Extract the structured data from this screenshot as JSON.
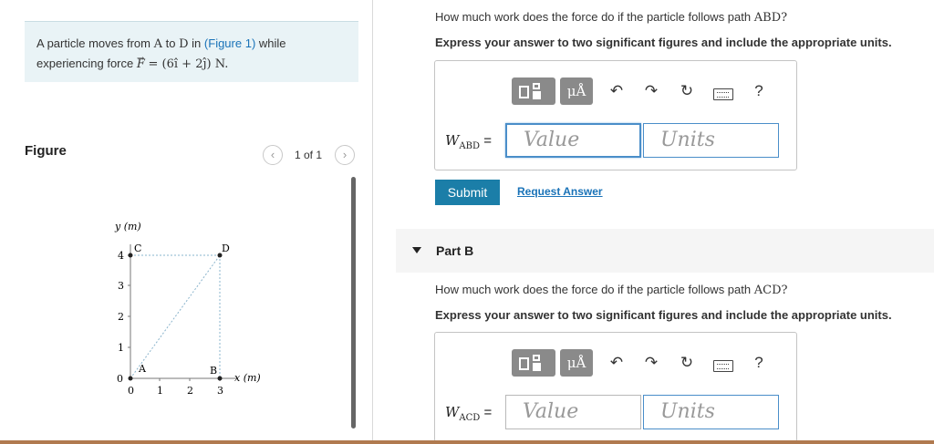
{
  "problem": {
    "text_1": "A particle moves from",
    "point_a": "A",
    "to": "to",
    "point_d": "D",
    "in": "in",
    "figure_link": "(Figure 1)",
    "while": "while",
    "text_2": "experiencing force",
    "force_symbol": "F",
    "force_eq": "= (6î + 2ĵ) N."
  },
  "figure": {
    "label": "Figure",
    "pager": "1 of 1",
    "prev_icon": "‹",
    "next_icon": "›"
  },
  "graph": {
    "ylabel": "y (m)",
    "xlabel": "x (m)",
    "x_ticks": [
      "0",
      "1",
      "2",
      "3"
    ],
    "y_ticks": [
      "1",
      "2",
      "3",
      "4"
    ],
    "y_zero": "0",
    "points": {
      "A": "A",
      "B": "B",
      "C": "C",
      "D": "D"
    }
  },
  "part_a": {
    "question": "How much work does the force do if the particle follows path",
    "path": "ABD?",
    "instruction": "Express your answer to two significant figures and include the appropriate units.",
    "var_main": "W",
    "var_sub": "ABD",
    "equals": "=",
    "value_placeholder": "Value",
    "units_placeholder": "Units",
    "submit": "Submit",
    "request": "Request Answer"
  },
  "part_b": {
    "title": "Part B",
    "question": "How much work does the force do if the particle follows path",
    "path": "ACD?",
    "instruction": "Express your answer to two significant figures and include the appropriate units.",
    "var_main": "W",
    "var_sub": "ACD",
    "equals": "=",
    "value_placeholder": "Value",
    "units_placeholder": "Units"
  },
  "toolbar": {
    "units_label": "μÅ",
    "help_label": "?",
    "icons": [
      "templates-icon",
      "units-icon",
      "undo-icon",
      "redo-icon",
      "reset-icon",
      "keyboard-icon",
      "help-icon"
    ]
  },
  "colors": {
    "accent": "#1b7ea8",
    "link": "#1a73b8",
    "problem_bg": "#e9f3f6",
    "focus": "#4a8ec9"
  }
}
